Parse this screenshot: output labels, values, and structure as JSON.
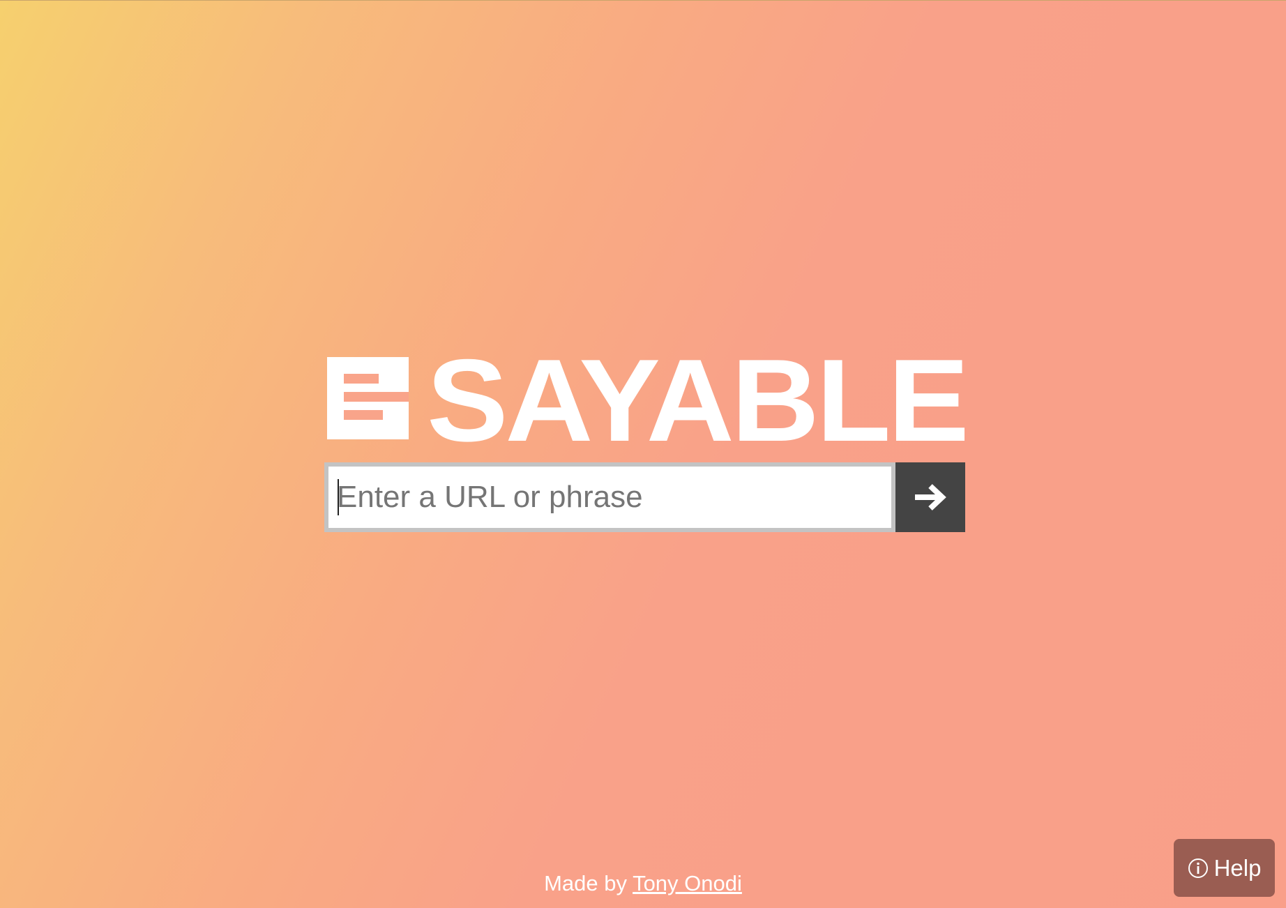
{
  "brand": {
    "name": "SAYABLE",
    "icon": "sayable-logo-icon"
  },
  "search": {
    "placeholder": "Enter a URL or phrase",
    "value": "",
    "submit_icon": "arrow-right-icon"
  },
  "footer": {
    "prefix": "Made by",
    "author_link": "Tony Onodi"
  },
  "help": {
    "label": "Help",
    "icon": "info-circle-icon"
  },
  "colors": {
    "gradient_start": "#f6d06e",
    "gradient_end": "#f99f89",
    "submit_bg": "#444444",
    "help_bg": "#9a5d52"
  }
}
